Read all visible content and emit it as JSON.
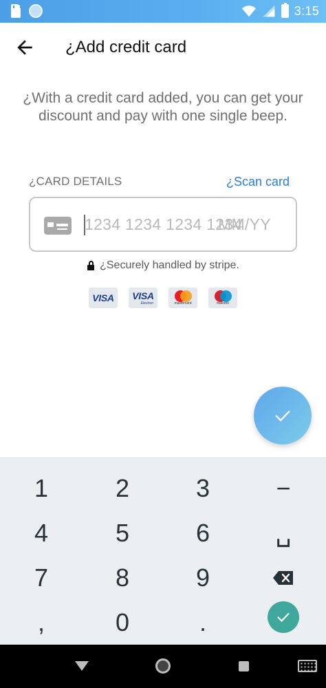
{
  "status_bar": {
    "time": "3:15",
    "icons": [
      "sd-card-icon",
      "circle-notification-icon",
      "wifi-icon",
      "signal-icon",
      "battery-charging-icon"
    ]
  },
  "app_bar": {
    "title": "¿Add credit card",
    "back_icon": "arrow-back-icon"
  },
  "intro_text": "¿With a credit card added, you can get your discount and pay with one single beep.",
  "card_section": {
    "label": "¿CARD DETAILS",
    "scan_link": "¿Scan card",
    "number_placeholder": "1234 1234 1234 1234",
    "expiry_placeholder": "MM/YY",
    "card_icon": "credit-card-icon"
  },
  "secure_note": "¿Securely handled by stripe.",
  "brands": [
    {
      "name": "visa",
      "label": "VISA"
    },
    {
      "name": "visa-electron",
      "label": "VISA",
      "caption": "Electron"
    },
    {
      "name": "mastercard",
      "caption": "mastercard"
    },
    {
      "name": "maestro",
      "caption": "maestro"
    }
  ],
  "fab_icon": "check-icon",
  "keyboard": {
    "rows": [
      [
        "1",
        "2",
        "3",
        "−"
      ],
      [
        "4",
        "5",
        "6",
        "␣"
      ],
      [
        "7",
        "8",
        "9",
        "⌫"
      ],
      [
        ",",
        "0",
        ".",
        "✓"
      ]
    ]
  },
  "nav_bar": [
    "back-nav-icon",
    "home-nav-icon",
    "recents-nav-icon",
    "keyboard-switch-icon"
  ],
  "colors": {
    "status_bar": "#4a9fe6",
    "link": "#2a7fd4",
    "fab": "#6cb9ec",
    "keyboard_bg": "#eceff1",
    "enter_key": "#3fa79b"
  }
}
